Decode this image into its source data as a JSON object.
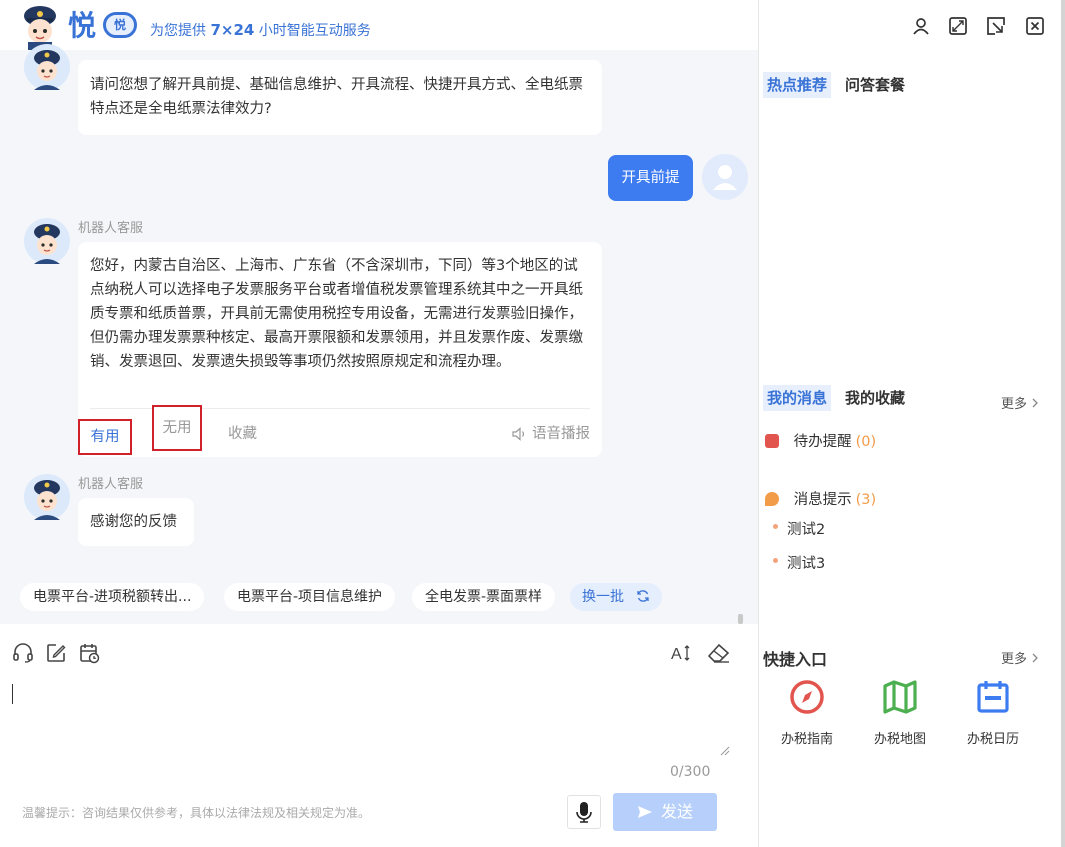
{
  "header": {
    "brand": "悦",
    "badge": "悦",
    "slogan_prefix": "为您提供",
    "slogan_highlight": "7×24",
    "slogan_suffix": "小时智能互动服务"
  },
  "chat": {
    "bot_name": "机器人客服",
    "messages": [
      {
        "text": "请问您想了解开具前提、基础信息维护、开具流程、快捷开具方式、全电纸票特点还是全电纸票法律效力?"
      },
      {
        "text": "开具前提"
      },
      {
        "text": "您好，内蒙古自治区、上海市、广东省（不含深圳市，下同）等3个地区的试点纳税人可以选择电子发票服务平台或者增值税发票管理系统其中之一开具纸质专票和纸质普票，开具前无需使用税控专用设备，无需进行发票验旧操作，但仍需办理发票票种核定、最高开票限额和发票领用，并且发票作废、发票缴销、发票退回、发票遗失损毁等事项仍然按照原规定和流程办理。"
      },
      {
        "text": "感谢您的反馈"
      }
    ],
    "feedback": {
      "useful": "有用",
      "useless": "无用",
      "favorite": "收藏",
      "voice": "语音播报"
    },
    "quick_tags": [
      "电票平台-进项税额转出...",
      "电票平台-项目信息维护",
      "全电发票-票面票样"
    ],
    "refresh_label": "换一批"
  },
  "input": {
    "value": "",
    "char_count": "0/300",
    "tip": "温馨提示：咨询结果仅供参考，具体以法律法规及相关规定为准。",
    "send_label": "发送",
    "font_icon_label": "A"
  },
  "sidebar": {
    "hot_tabs": [
      "热点推荐",
      "问答套餐"
    ],
    "msg_tabs": [
      "我的消息",
      "我的收藏"
    ],
    "more_label": "更多",
    "todo": {
      "label": "待办提醒",
      "count": "(0)"
    },
    "notice": {
      "label": "消息提示",
      "count": "(3)"
    },
    "notice_items": [
      "测试2",
      "测试3"
    ],
    "quick_entry_title": "快捷入口",
    "shortcuts": [
      {
        "label": "办税指南",
        "icon": "compass-icon",
        "color": "#e2554f"
      },
      {
        "label": "办税地图",
        "icon": "map-icon",
        "color": "#4caf50"
      },
      {
        "label": "办税日历",
        "icon": "calendar-icon",
        "color": "#3d7bf0"
      }
    ]
  },
  "colors": {
    "accent": "#3d7bf0",
    "highlight_box": "#d0202a",
    "count_orange": "#f29c4a"
  }
}
